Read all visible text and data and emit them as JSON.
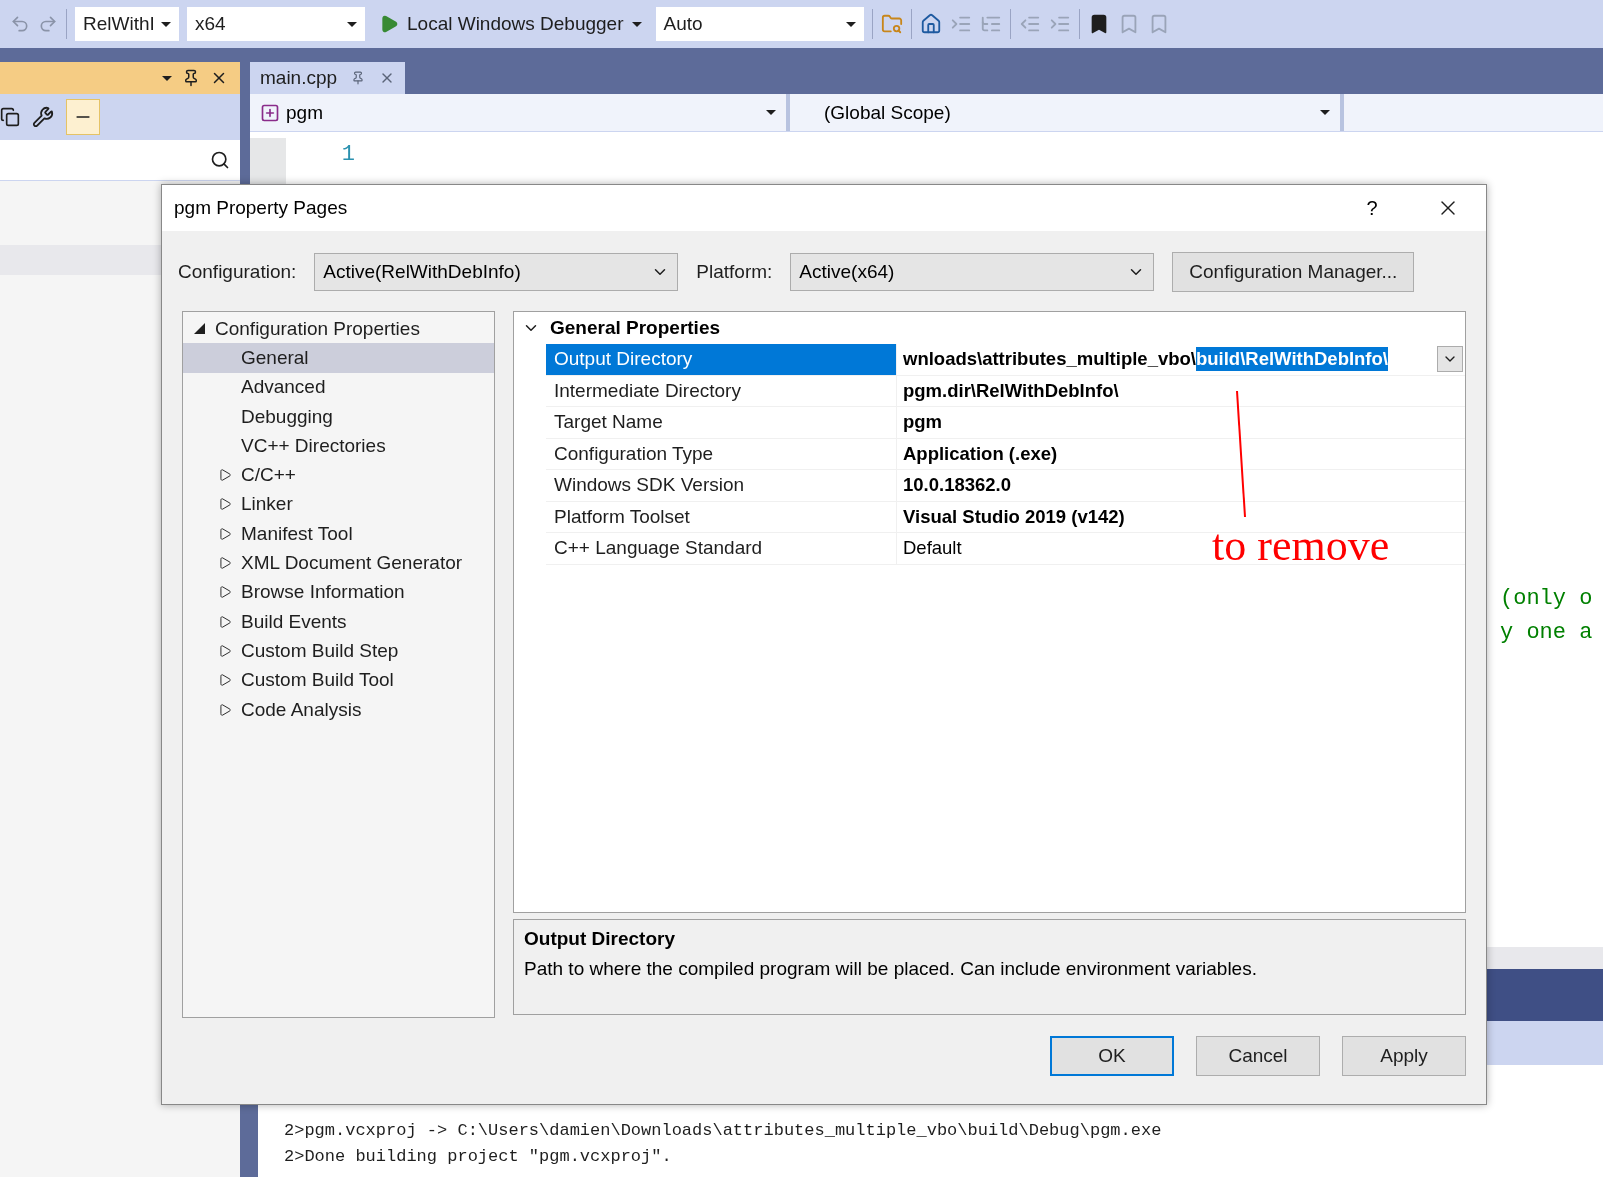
{
  "toolbar": {
    "configuration": "RelWithI",
    "platform": "x64",
    "debugger": "Local Windows Debugger",
    "mode": "Auto"
  },
  "editor": {
    "tab": {
      "label": "main.cpp",
      "selected": true
    },
    "project": "pgm",
    "scope": "(Global Scope)",
    "lines": [
      {
        "number": "1"
      }
    ],
    "comment_lines": [
      "(only o",
      "y one a"
    ]
  },
  "output": [
    "2>pgm.vcxproj -> C:\\Users\\damien\\Downloads\\attributes_multiple_vbo\\build\\Debug\\pgm.exe",
    "2>Done building project \"pgm.vcxproj\"."
  ],
  "dialog": {
    "title": "pgm Property Pages",
    "help": "?",
    "configuration_label": "Configuration:",
    "configuration": "Active(RelWithDebInfo)",
    "platform_label": "Platform:",
    "platform": "Active(x64)",
    "manager_button": "Configuration Manager...",
    "tree": [
      {
        "label": "Configuration Properties",
        "expanded": true,
        "selected": false,
        "children": [
          {
            "label": "General",
            "selected": true
          },
          {
            "label": "Advanced",
            "selected": false
          },
          {
            "label": "Debugging",
            "selected": false
          },
          {
            "label": "VC++ Directories",
            "selected": false
          },
          {
            "label": "C/C++",
            "selected": false,
            "expanded": false
          },
          {
            "label": "Linker",
            "selected": false,
            "expanded": false
          },
          {
            "label": "Manifest Tool",
            "selected": false,
            "expanded": false
          },
          {
            "label": "XML Document Generator",
            "selected": false,
            "expanded": false
          },
          {
            "label": "Browse Information",
            "selected": false,
            "expanded": false
          },
          {
            "label": "Build Events",
            "selected": false,
            "expanded": false
          },
          {
            "label": "Custom Build Step",
            "selected": false,
            "expanded": false
          },
          {
            "label": "Custom Build Tool",
            "selected": false,
            "expanded": false
          },
          {
            "label": "Code Analysis",
            "selected": false,
            "expanded": false
          }
        ]
      }
    ],
    "group": {
      "label": "General Properties",
      "expanded": true
    },
    "properties": [
      {
        "name": "Output Directory",
        "value": "wnloads\\attributes_multiple_vbo\\",
        "highlighted_value": "build\\RelWithDebInfo\\",
        "bold": true,
        "selected": true
      },
      {
        "name": "Intermediate Directory",
        "value": "pgm.dir\\RelWithDebInfo\\",
        "bold": true,
        "selected": false
      },
      {
        "name": "Target Name",
        "value": "pgm",
        "bold": true,
        "selected": false
      },
      {
        "name": "Configuration Type",
        "value": "Application (.exe)",
        "bold": true,
        "selected": false
      },
      {
        "name": "Windows SDK Version",
        "value": "10.0.18362.0",
        "bold": true,
        "selected": false
      },
      {
        "name": "Platform Toolset",
        "value": "Visual Studio 2019 (v142)",
        "bold": true,
        "selected": false
      },
      {
        "name": "C++ Language Standard",
        "value": "Default",
        "bold": false,
        "selected": false
      }
    ],
    "annotation": "to remove",
    "description": {
      "title": "Output Directory",
      "text": "Path to where the compiled program will be placed. Can include environment variables."
    },
    "buttons": [
      {
        "label": "OK",
        "default": true
      },
      {
        "label": "Cancel",
        "default": false
      },
      {
        "label": "Apply",
        "default": false
      }
    ]
  }
}
